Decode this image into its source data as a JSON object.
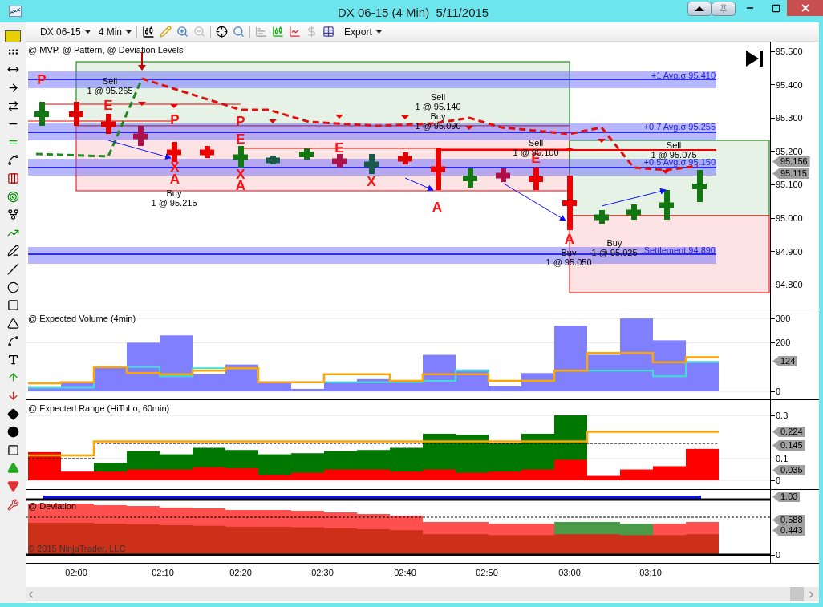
{
  "window": {
    "title": "DX 06-15 (4 Min)  5/11/2015"
  },
  "toolbar": {
    "instrument": "DX 06-15",
    "interval": "4 Min",
    "export": "Export"
  },
  "price_panel": {
    "title": "@ MVP, @ Pattern, @ Deviation Levels",
    "levels": [
      "+1 Avg.σ 95.410",
      "+0.7 Avg.σ 95.255",
      "+0.5 Avg.σ 95.150",
      "Settlement 94.890"
    ],
    "trades": [
      {
        "side": "Sell",
        "fill": "1 @ 95.265"
      },
      {
        "side": "Buy",
        "fill": "1 @ 95.215"
      },
      {
        "side": "Sell",
        "fill": "1 @ 95.140"
      },
      {
        "side": "Buy",
        "fill": "1 @ 95.090"
      },
      {
        "side": "Sell",
        "fill": "1 @ 95.100"
      },
      {
        "side": "Sell",
        "fill": "1 @ 95.075"
      },
      {
        "side": "Buy",
        "fill": "1 @ 95.025"
      },
      {
        "side": "Buy",
        "fill": "1 @ 95.050"
      }
    ],
    "marks": [
      "P",
      "E",
      "P",
      "X",
      "A",
      "P",
      "E",
      "X",
      "A",
      "E",
      "X",
      "A",
      "E",
      "A"
    ],
    "axis": [
      "95.500",
      "95.400",
      "95.300",
      "95.200",
      "95.100",
      "95.000",
      "94.900",
      "94.800"
    ],
    "price_flags": [
      "95.156",
      "95.115"
    ]
  },
  "volume_panel": {
    "title": "@ Expected Volume (4min)",
    "axis": [
      "300",
      "200",
      "0"
    ],
    "flags": [
      "124"
    ]
  },
  "range_panel": {
    "title": "@ Expected Range (HiToLo, 60min)",
    "axis": [
      "0.3",
      "0.1",
      "0"
    ],
    "flags": [
      "0.224",
      "0.145",
      "0.035"
    ]
  },
  "deviation_panel": {
    "title": "@ Deviation",
    "flags": [
      "1.03",
      "0.588",
      "0.443"
    ],
    "axis": [
      "0"
    ],
    "copyright": "© 2015 NinjaTrader, LLC"
  },
  "time_axis": [
    "02:00",
    "02:10",
    "02:20",
    "02:30",
    "02:40",
    "02:50",
    "03:00",
    "03:10"
  ]
}
